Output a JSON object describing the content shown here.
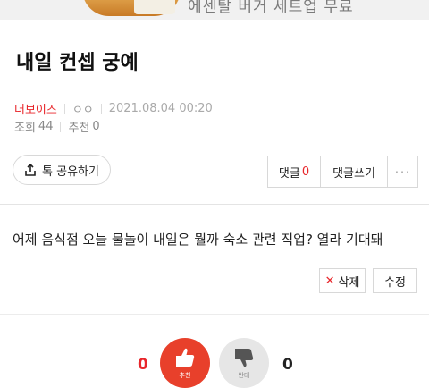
{
  "ad": {
    "text": "에센탈 버거 세트업 무료"
  },
  "post": {
    "title": "내일 컨셉 궁예",
    "author": "더보이즈",
    "nickname": "ㅇㅇ",
    "datetime": "2021.08.04 00:20",
    "views_label": "조회",
    "views": "44",
    "recommend_label": "추천",
    "recommend": "0",
    "body": "어제 음식점 오늘 물놀이 내일은 뭘까 숙소 관련 직업? 열라 기대돼"
  },
  "actions": {
    "share_label": "톡 공유하기",
    "comments_label": "댓글",
    "comments_count": "0",
    "write_comment_label": "댓글쓰기",
    "more_label": "···",
    "delete_label": "삭제",
    "edit_label": "수정"
  },
  "vote": {
    "like_count": "0",
    "dislike_count": "0",
    "like_label": "추천",
    "dislike_label": "반대"
  },
  "colors": {
    "accent": "#e8262b",
    "like_bg": "#e8402b",
    "dislike_bg": "#e6e6e6"
  }
}
